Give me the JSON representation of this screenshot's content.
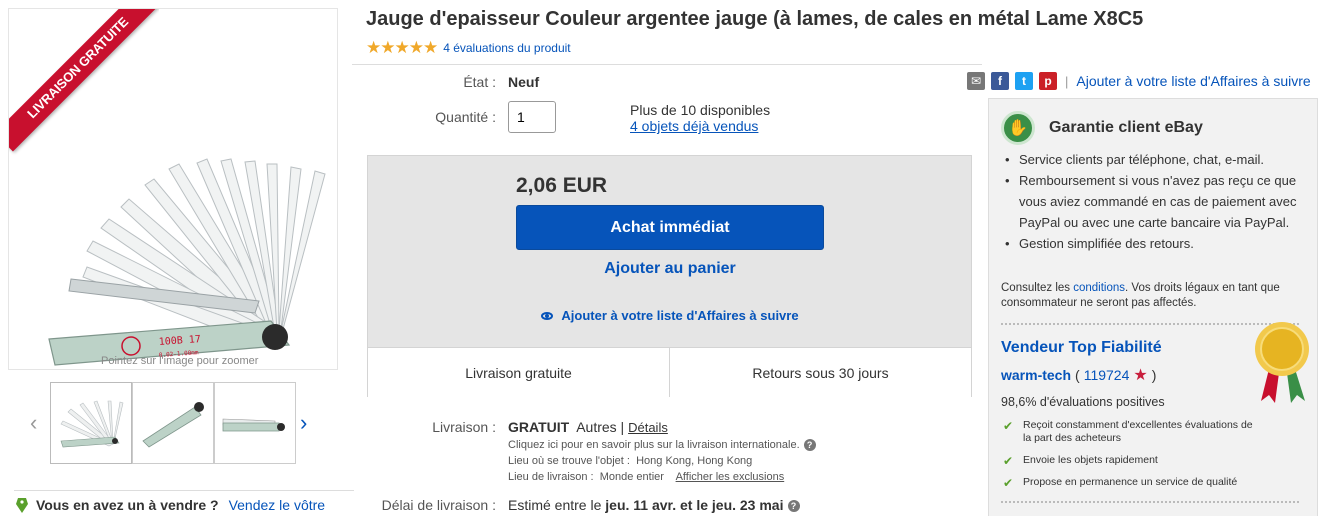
{
  "colors": {
    "link": "#0654ba",
    "ribbon": "#c8102e",
    "star": "#f0a82a",
    "check": "#5aa02c"
  },
  "gallery": {
    "ribbon": "LIVRAISON GRATUITE",
    "zoom_hint": "Pointez sur l'image pour zoomer",
    "prev_icon": "chevron-left-icon",
    "next_icon": "chevron-right-icon",
    "sell_question": "Vous en avez un à vendre ?",
    "sell_link": "Vendez le vôtre"
  },
  "item": {
    "title": "Jauge d'epaisseur Couleur argentee jauge (à lames, de cales en métal Lame X8C5",
    "rating_stars": 5,
    "reviews_link": "4 évaluations du produit",
    "etat_label": "État :",
    "etat_value": "Neuf",
    "qty_label": "Quantité :",
    "qty_value": "1",
    "available": "Plus de 10 disponibles",
    "sold_link": "4 objets déjà vendus"
  },
  "buybox": {
    "price": "2,06 EUR",
    "buy_now": "Achat immédiat",
    "add_cart": "Ajouter au panier",
    "watch": "Ajouter à votre liste d'Affaires à suivre",
    "shipping_free": "Livraison gratuite",
    "returns": "Retours sous 30 jours"
  },
  "delivery": {
    "label": "Livraison :",
    "free": "GRATUIT",
    "others": "Autres |",
    "details_link": "Détails",
    "intl_note": "Cliquez ici pour en savoir plus sur la livraison internationale.",
    "location_label": "Lieu où se trouve l'objet :",
    "location_value": "Hong Kong, Hong Kong",
    "ship_to_label": "Lieu de livraison :",
    "ship_to_value": "Monde entier",
    "exclusions_link": "Afficher les exclusions",
    "delai_label": "Délai de livraison :",
    "delai_prefix": "Estimé entre le",
    "delai_dates": "jeu. 11 avr. et le jeu. 23 mai"
  },
  "share": {
    "icons": [
      "mail-icon",
      "facebook-icon",
      "twitter-icon",
      "pinterest-icon"
    ],
    "watch_link": "Ajouter à votre liste d'Affaires à suivre"
  },
  "guarantee": {
    "title": "Garantie client eBay",
    "items": [
      "Service clients par téléphone, chat, e-mail.",
      "Remboursement si vous n'avez pas reçu ce que vous aviez commandé en cas de paiement avec PayPal ou avec une carte bancaire via PayPal.",
      "Gestion simplifiée des retours."
    ],
    "note_prefix": "Consultez les",
    "note_link": "conditions",
    "note_suffix": ". Vos droits légaux en tant que consommateur ne seront pas affectés."
  },
  "seller": {
    "badge_title": "Vendeur Top Fiabilité",
    "name": "warm-tech",
    "score_open": "(",
    "score": "119724",
    "score_close": ")",
    "feedback": "98,6% d'évaluations positives",
    "checks": [
      "Reçoit constamment d'excellentes évaluations de la part des acheteurs",
      "Envoie les objets rapidement",
      "Propose en permanence un service de qualité"
    ]
  }
}
